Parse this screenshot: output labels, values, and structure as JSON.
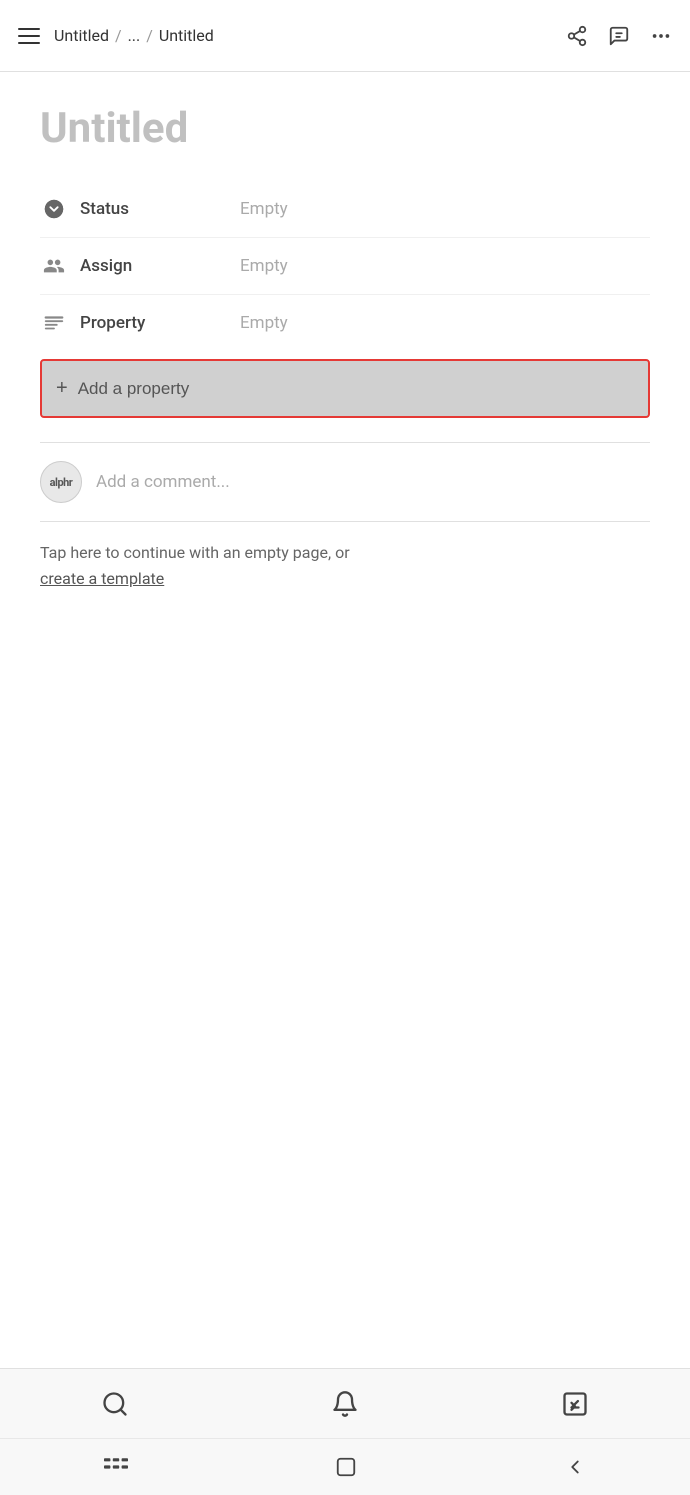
{
  "header": {
    "breadcrumb": {
      "part1": "Untitled",
      "sep1": "/",
      "part2": "...",
      "sep2": "/",
      "part3": "Untitled"
    }
  },
  "page": {
    "title": "Untitled"
  },
  "properties": [
    {
      "id": "status",
      "icon": "status-icon",
      "label": "Status",
      "value": "Empty"
    },
    {
      "id": "assign",
      "icon": "assign-icon",
      "label": "Assign",
      "value": "Empty"
    },
    {
      "id": "property",
      "icon": "property-icon",
      "label": "Property",
      "value": "Empty"
    }
  ],
  "add_property": {
    "label": "Add a property"
  },
  "comment": {
    "avatar_text": "alphr",
    "placeholder": "Add a comment..."
  },
  "hint": {
    "text": "Tap here to continue with an empty page, or",
    "link": "create a template"
  },
  "bottom_nav": {
    "search_label": "search",
    "bell_label": "notifications",
    "edit_label": "edit",
    "menu_label": "menu",
    "home_label": "home",
    "back_label": "back"
  }
}
